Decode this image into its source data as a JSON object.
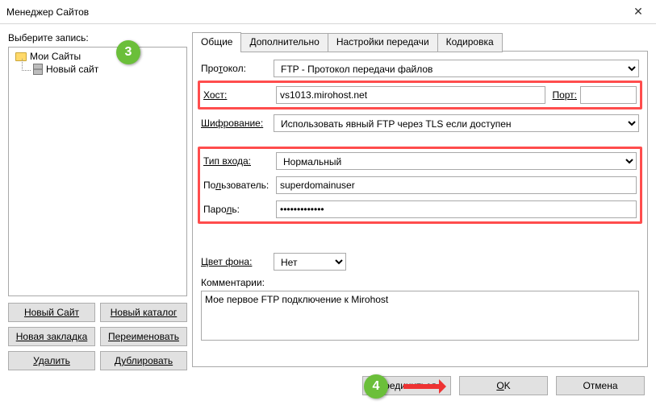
{
  "title": "Менеджер Сайтов",
  "left": {
    "label": "Выберите запись:",
    "root": "Мои Сайты",
    "child": "Новый сайт",
    "btns": {
      "new_site": "Новый Сайт",
      "new_folder": "Новый каталог",
      "new_bookmark": "Новая закладка",
      "rename": "Переименовать",
      "delete": "Удалить",
      "duplicate": "Дублировать"
    }
  },
  "tabs": {
    "t1": "Общие",
    "t2": "Дополнительно",
    "t3": "Настройки передачи",
    "t4": "Кодировка"
  },
  "form": {
    "protocol_label": "Протокол:",
    "protocol_value": "FTP - Протокол передачи файлов",
    "host_label": "Хост:",
    "host_value": "vs1013.mirohost.net",
    "port_label": "Порт:",
    "port_value": "",
    "enc_label": "Шифрование:",
    "enc_value": "Использовать явный FTP через TLS если доступен",
    "logon_label": "Тип входа:",
    "logon_value": "Нормальный",
    "user_label": "Пользователь:",
    "user_value": "superdomainuser",
    "pass_label": "Пароль:",
    "pass_value": "superpassword",
    "bg_label": "Цвет фона:",
    "bg_value": "Нет",
    "comments_label": "Комментарии:",
    "comments_value": "Мое первое FTP подключение к Mirohost"
  },
  "footer": {
    "connect": "Соединиться",
    "ok": "OK",
    "cancel": "Отмена"
  },
  "badges": {
    "b3": "3",
    "b4": "4"
  }
}
